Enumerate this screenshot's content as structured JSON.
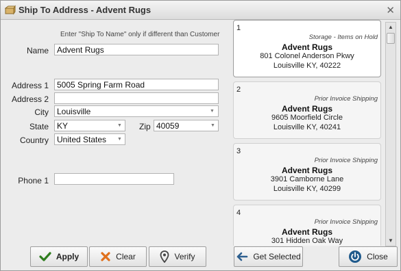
{
  "window": {
    "title": "Ship To Address - Advent Rugs",
    "close_glyph": "✕"
  },
  "form": {
    "hint": "Enter \"Ship To Name\" only if different than Customer",
    "name_label": "Name",
    "name_value": "Advent Rugs",
    "address1_label": "Address 1",
    "address1_value": "5005 Spring Farm Road",
    "address2_label": "Address 2",
    "address2_value": "",
    "city_label": "City",
    "city_value": "Louisville",
    "state_label": "State",
    "state_value": "KY",
    "zip_label": "Zip",
    "zip_value": "40059",
    "country_label": "Country",
    "country_value": "United States",
    "phone1_label": "Phone 1",
    "phone1_value": ""
  },
  "buttons": {
    "apply": "Apply",
    "clear": "Clear",
    "verify": "Verify",
    "get_selected": "Get Selected",
    "close": "Close"
  },
  "addresses": [
    {
      "num": "1",
      "note": "Storage - Items on Hold",
      "name": "Advent Rugs",
      "line1": "801 Colonel Anderson Pkwy",
      "line2": "Louisville KY, 40222"
    },
    {
      "num": "2",
      "note": "Prior Invoice Shipping",
      "name": "Advent Rugs",
      "line1": "9605 Moorfield Circle",
      "line2": "Louisville KY, 40241"
    },
    {
      "num": "3",
      "note": "Prior Invoice Shipping",
      "name": "Advent Rugs",
      "line1": "3901 Camborne Lane",
      "line2": "Louisville KY, 40299"
    },
    {
      "num": "4",
      "note": "Prior Invoice Shipping",
      "name": "Advent Rugs",
      "line1": "301 Hidden Oak Way",
      "line2": ""
    }
  ],
  "colors": {
    "apply_check": "#2e7d1e",
    "clear_x": "#e0701c",
    "close_icon": "#1f5a8c",
    "arrow_icon": "#2d5f8f"
  },
  "icons": [
    "window-icon",
    "close-icon",
    "checkmark-icon",
    "clear-x-icon",
    "location-pin-icon",
    "arrow-left-icon",
    "power-icon"
  ]
}
